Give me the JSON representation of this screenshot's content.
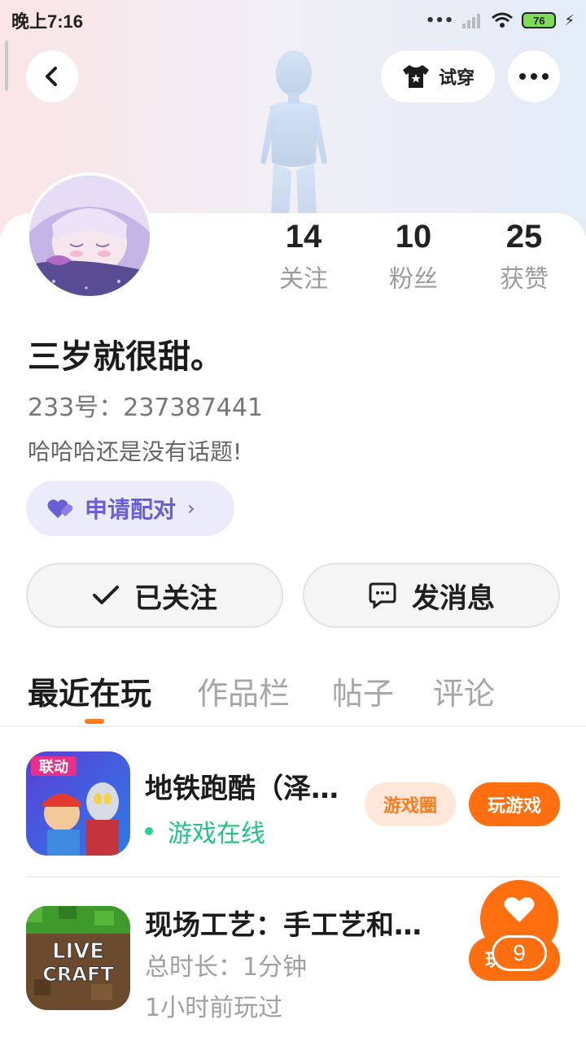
{
  "status_bar": {
    "time": "晚上7:16",
    "battery": "76"
  },
  "header": {
    "try_on_label": "试穿"
  },
  "profile": {
    "nickname": "三岁就很甜。",
    "uid": "233号：237387441",
    "signature": "哈哈哈还是没有话题!",
    "pair_label": "申请配对",
    "pair_chevron": "›"
  },
  "stats": [
    {
      "value": "14",
      "label": "关注"
    },
    {
      "value": "10",
      "label": "粉丝"
    },
    {
      "value": "25",
      "label": "获赞"
    }
  ],
  "actions": {
    "follow_label": "已关注",
    "message_label": "发消息"
  },
  "tabs": [
    {
      "label": "最近在玩",
      "active": true
    },
    {
      "label": "作品栏",
      "active": false
    },
    {
      "label": "帖子",
      "active": false
    },
    {
      "label": "评论",
      "active": false
    }
  ],
  "games": [
    {
      "title": "地铁跑酷（泽…",
      "status": "游戏在线",
      "circle_label": "游戏圈",
      "play_label": "玩游戏",
      "badge": "联动"
    },
    {
      "title": "现场工艺：手工艺和…",
      "total_time": "总时长：1分钟",
      "last_played": "1小时前玩过",
      "play_label": "玩",
      "icon_text_1": "LIVE",
      "icon_text_2": "CRAFT"
    }
  ],
  "fab": {
    "count": "9"
  },
  "colors": {
    "accent": "#ff6f10",
    "pair": "#6a5ed6",
    "online": "#22c384"
  }
}
